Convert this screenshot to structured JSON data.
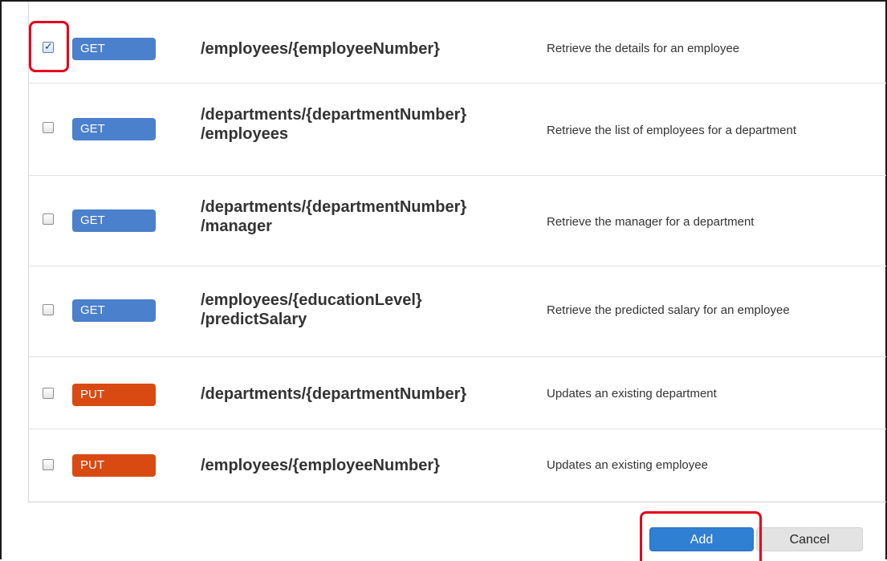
{
  "operations": [
    {
      "checked": true,
      "method": "GET",
      "path_line1": "/employees/{employeeNumber}",
      "path_line2": "",
      "description": "Retrieve the details for an employee"
    },
    {
      "checked": false,
      "method": "GET",
      "path_line1": "/departments/{departmentNumber}",
      "path_line2": "/employees",
      "description": "Retrieve the list of employees for a department"
    },
    {
      "checked": false,
      "method": "GET",
      "path_line1": "/departments/{departmentNumber}",
      "path_line2": "/manager",
      "description": "Retrieve the manager for a department"
    },
    {
      "checked": false,
      "method": "GET",
      "path_line1": "/employees/{educationLevel}",
      "path_line2": "/predictSalary",
      "description": "Retrieve the predicted salary for an employee"
    },
    {
      "checked": false,
      "method": "PUT",
      "path_line1": "/departments/{departmentNumber}",
      "path_line2": "",
      "description": "Updates an existing department"
    },
    {
      "checked": false,
      "method": "PUT",
      "path_line1": "/employees/{employeeNumber}",
      "path_line2": "",
      "description": "Updates an existing employee"
    }
  ],
  "footer": {
    "add_label": "Add",
    "cancel_label": "Cancel"
  },
  "colors": {
    "get": "#4b80cc",
    "put": "#d94a12",
    "highlight": "#e5001b",
    "primary": "#2f7fd3"
  }
}
